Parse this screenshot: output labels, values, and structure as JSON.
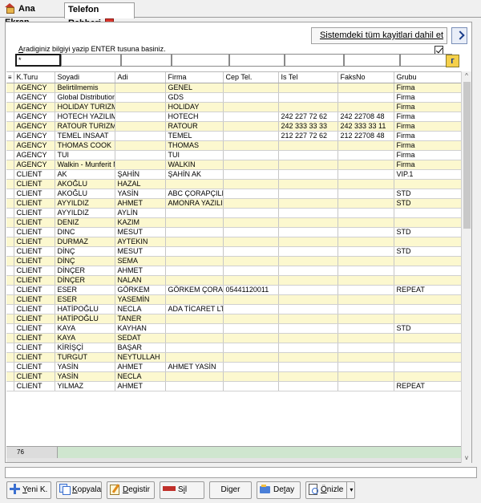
{
  "tabs": [
    {
      "label": "Ana Ekran",
      "icon": "home-icon"
    },
    {
      "label": "Telefon Rehberi",
      "icon": "close-icon",
      "active": true
    }
  ],
  "tab_close_glyph": "×",
  "include_all": {
    "label": "Sistemdeki tüm kayitlari dahil et",
    "checked": true
  },
  "hint": {
    "first_letter": "A",
    "rest": "radiginiz bilgiyi yazip ENTER tusuna basiniz."
  },
  "filters": [
    "*",
    "",
    "",
    "",
    "",
    "",
    "",
    ""
  ],
  "columns": [
    "K.Turu",
    "Soyadi",
    "Adi",
    "Firma",
    "Cep Tel.",
    "Is Tel",
    "FaksNo",
    "Grubu"
  ],
  "indicator_glyph": "≡",
  "rows": [
    [
      "AGENCY",
      "Belirtilmemis",
      "",
      "GENEL",
      "",
      "",
      "",
      "Firma"
    ],
    [
      "AGENCY",
      "Global Distribution",
      "",
      "GDS",
      "",
      "",
      "",
      "Firma"
    ],
    [
      "AGENCY",
      "HOLIDAY TURIZM",
      "",
      "HOLIDAY",
      "",
      "",
      "",
      "Firma"
    ],
    [
      "AGENCY",
      "HOTECH YAZILIM",
      "",
      "HOTECH",
      "",
      "242 227 72 62",
      "242 22708 48",
      "Firma"
    ],
    [
      "AGENCY",
      "RATOUR TURIZM",
      "",
      "RATOUR",
      "",
      "242 333 33 33",
      "242 333 33 11",
      "Firma"
    ],
    [
      "AGENCY",
      "TEMEL INSAAT",
      "",
      "TEMEL",
      "",
      "212 227 72 62",
      "212 22708 48",
      "Firma"
    ],
    [
      "AGENCY",
      "THOMAS COOK",
      "",
      "THOMAS",
      "",
      "",
      "",
      "Firma"
    ],
    [
      "AGENCY",
      "TUI",
      "",
      "TUI",
      "",
      "",
      "",
      "Firma"
    ],
    [
      "AGENCY",
      "Walkin - Munferit M",
      "",
      "WALKIN",
      "",
      "",
      "",
      "Firma"
    ],
    [
      "CLIENT",
      "AK",
      "ŞAHİN",
      "ŞAHİN AK",
      "",
      "",
      "",
      "VIP.1"
    ],
    [
      "CLIENT",
      "AKOĞLU",
      "HAZAL",
      "",
      "",
      "",
      "",
      ""
    ],
    [
      "CLIENT",
      "AKOĞLU",
      "YASİN",
      "ABC ÇORAPÇILII",
      "",
      "",
      "",
      "STD"
    ],
    [
      "CLIENT",
      "AYYILDIZ",
      "AHMET",
      "AMONRA YAZILIM",
      "",
      "",
      "",
      "STD"
    ],
    [
      "CLIENT",
      "AYYILDIZ",
      "AYLİN",
      "",
      "",
      "",
      "",
      ""
    ],
    [
      "CLIENT",
      "DENIZ",
      "KAZIM",
      "",
      "",
      "",
      "",
      ""
    ],
    [
      "CLIENT",
      "DINC",
      "MESUT",
      "",
      "",
      "",
      "",
      "STD"
    ],
    [
      "CLIENT",
      "DURMAZ",
      "AYTEKIN",
      "",
      "",
      "",
      "",
      ""
    ],
    [
      "CLIENT",
      "DİNÇ",
      "MESUT",
      "",
      "",
      "",
      "",
      "STD"
    ],
    [
      "CLIENT",
      "DİNÇ",
      "SEMA",
      "",
      "",
      "",
      "",
      ""
    ],
    [
      "CLIENT",
      "DİNÇER",
      "AHMET",
      "",
      "",
      "",
      "",
      ""
    ],
    [
      "CLIENT",
      "DİNÇER",
      "NALAN",
      "",
      "",
      "",
      "",
      ""
    ],
    [
      "CLIENT",
      "ESER",
      "GÖRKEM",
      "GÖRKEM ÇORAF",
      "05441120011",
      "",
      "",
      "REPEAT"
    ],
    [
      "CLIENT",
      "ESER",
      "YASEMİN",
      "",
      "",
      "",
      "",
      ""
    ],
    [
      "CLIENT",
      "HATİPOĞLU",
      "NECLA",
      "ADA TİCARET LT",
      "",
      "",
      "",
      ""
    ],
    [
      "CLIENT",
      "HATİPOĞLU",
      "TANER",
      "",
      "",
      "",
      "",
      ""
    ],
    [
      "CLIENT",
      "KAYA",
      "KAYHAN",
      "",
      "",
      "",
      "",
      "STD"
    ],
    [
      "CLIENT",
      "KAYA",
      "SEDAT",
      "",
      "",
      "",
      "",
      ""
    ],
    [
      "CLIENT",
      "KİRİŞÇİ",
      "BAŞAR",
      "",
      "",
      "",
      "",
      ""
    ],
    [
      "CLIENT",
      "TURGUT",
      "NEYTULLAH",
      "",
      "",
      "",
      "",
      ""
    ],
    [
      "CLIENT",
      "YASİN",
      "AHMET",
      "AHMET YASİN",
      "",
      "",
      "",
      ""
    ],
    [
      "CLIENT",
      "YASİN",
      "NECLA",
      "",
      "",
      "",
      "",
      ""
    ],
    [
      "CLIENT",
      "YILMAZ",
      "AHMET",
      "",
      "",
      "",
      "",
      "REPEAT"
    ]
  ],
  "record_count": "76",
  "colors": {
    "row_alt": "#fcf8cf",
    "footer": "#cfe6cf",
    "accent": "#1a3d8a"
  },
  "scroll_glyphs": {
    "up": "^",
    "down": "v"
  },
  "buttons": {
    "new": {
      "accel": "Y",
      "rest": "eni K."
    },
    "copy": {
      "accel": "K",
      "rest": "opyala"
    },
    "edit": {
      "accel": "D",
      "rest": "egistir"
    },
    "delete": {
      "pre": "S",
      "accel": "i",
      "rest": "l"
    },
    "other": {
      "label": "Diger"
    },
    "detail": {
      "pre": "De",
      "accel": "t",
      "rest": "ay"
    },
    "preview": {
      "accel": "Ö",
      "rest": "nizle",
      "dropdown": "▾"
    }
  }
}
